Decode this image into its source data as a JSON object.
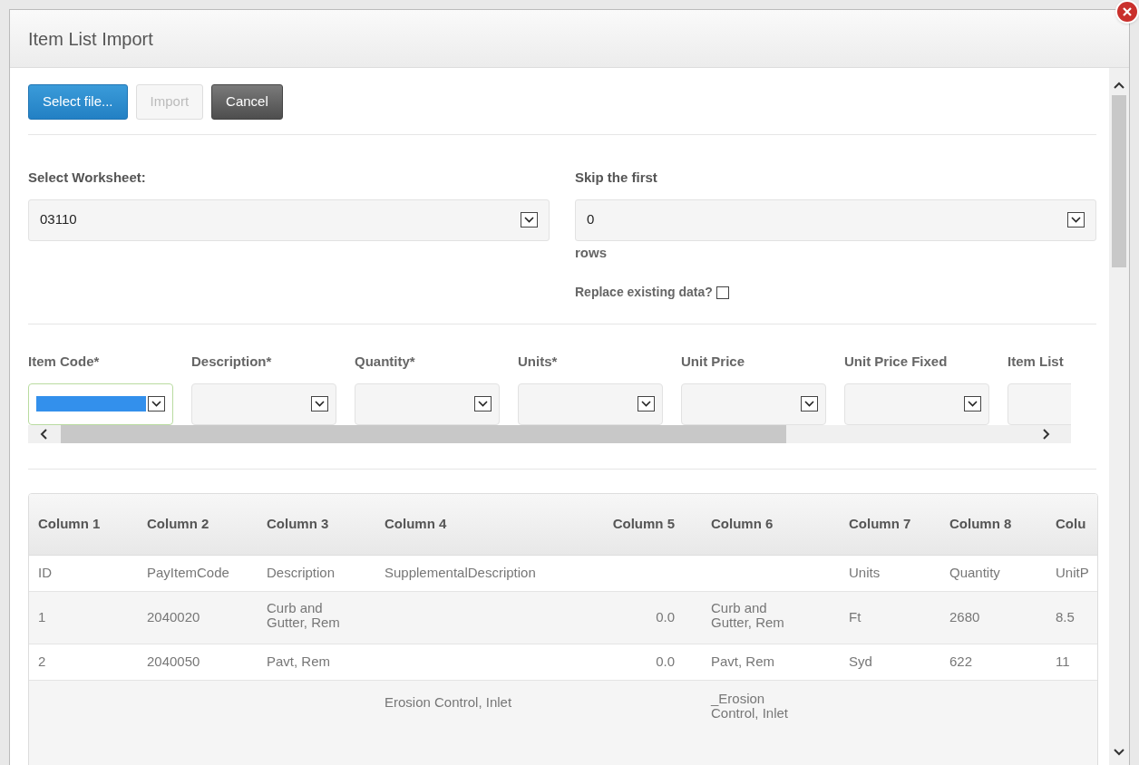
{
  "window": {
    "title": "Item List Import"
  },
  "toolbar": [
    {
      "label": "Select file...",
      "kind": "primary",
      "disabled": false
    },
    {
      "label": "Import",
      "disabled": true
    },
    {
      "label": "Cancel",
      "kind": "dark",
      "disabled": false
    }
  ],
  "worksheet": {
    "label": "Select Worksheet:",
    "value": "03110"
  },
  "skip": {
    "label": "Skip the first",
    "value": "0",
    "suffix": "rows"
  },
  "replace": {
    "label": "Replace existing data?",
    "checked": false
  },
  "mapping": [
    {
      "label": "Item Code*",
      "focused": true
    },
    {
      "label": "Description*",
      "focused": false
    },
    {
      "label": "Quantity*",
      "focused": false
    },
    {
      "label": "Units*",
      "focused": false
    },
    {
      "label": "Unit Price",
      "focused": false
    },
    {
      "label": "Unit Price Fixed",
      "focused": false
    },
    {
      "label": "Item List",
      "focused": false
    }
  ],
  "table": {
    "columns": [
      "Column 1",
      "Column 2",
      "Column 3",
      "Column 4",
      "Column 5",
      "Column 6",
      "Column 7",
      "Column 8",
      "Colu"
    ],
    "rows": [
      [
        "ID",
        "PayItemCode",
        "Description",
        "SupplementalDescription",
        "",
        "",
        "Units",
        "Quantity",
        "UnitP"
      ],
      [
        "1",
        "2040020",
        "Curb and Gutter, Rem",
        "",
        "0.0",
        "Curb and Gutter, Rem",
        "Ft",
        "2680",
        "8.5"
      ],
      [
        "2",
        "2040050",
        "Pavt, Rem",
        "",
        "0.0",
        "Pavt, Rem",
        "Syd",
        "622",
        "11"
      ],
      [
        "",
        "",
        "",
        "Erosion Control, Inlet",
        "",
        "_Erosion Control, Inlet",
        "",
        "",
        ""
      ]
    ]
  }
}
